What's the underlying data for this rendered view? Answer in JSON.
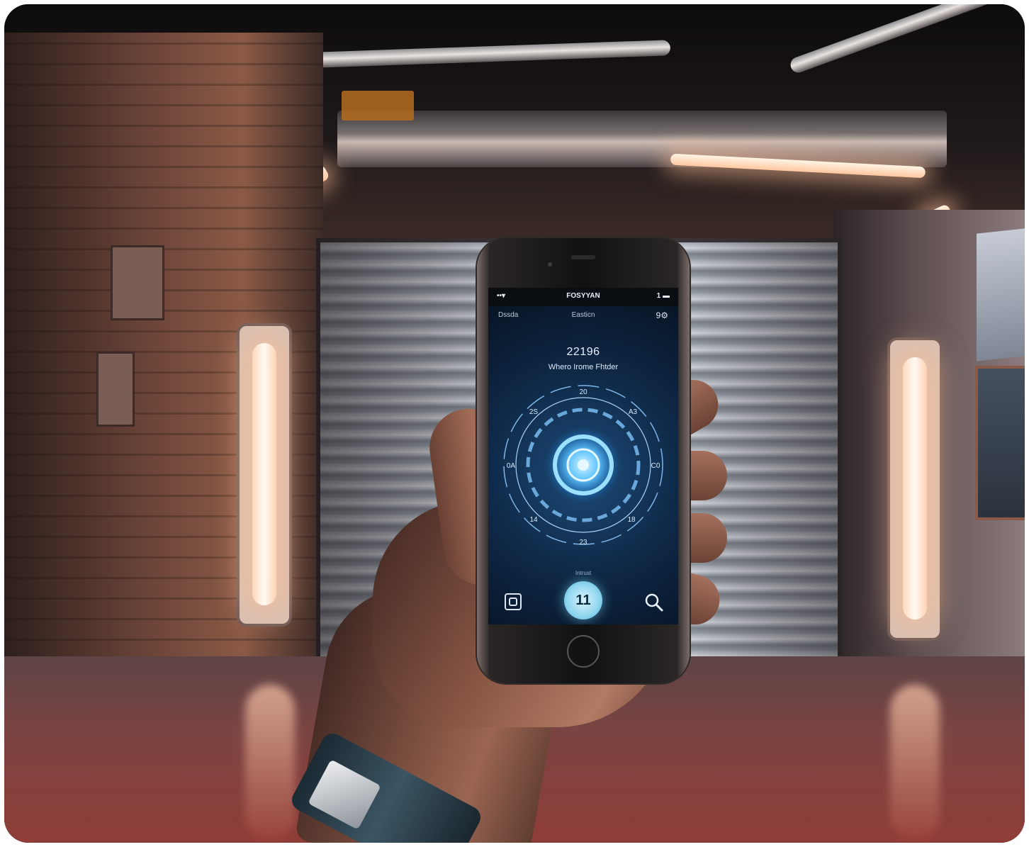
{
  "phone_screen": {
    "status_bar": {
      "left_text": "••▾",
      "title": "FOSYYAN",
      "right_text": "1 ▬"
    },
    "nav": {
      "left": "Dssda",
      "center": "Easticn",
      "right": "9⚙"
    },
    "headline": "22196",
    "subline": "Whero Irome Fhtder",
    "dial_labels": [
      "20",
      "A3",
      "C0",
      "18",
      "23",
      "14",
      "0A",
      "2S"
    ],
    "caption": "Intrust",
    "center_button_label": "11",
    "left_tool_icon": "copy-icon",
    "right_tool_icon": "search-icon"
  },
  "colors": {
    "screen_bg": "#0f2a49",
    "dial_glow": "#5fc3ff",
    "center_button": "#8fd6ef",
    "light_warm": "#ffd8bd",
    "floor": "#8f3d37"
  }
}
